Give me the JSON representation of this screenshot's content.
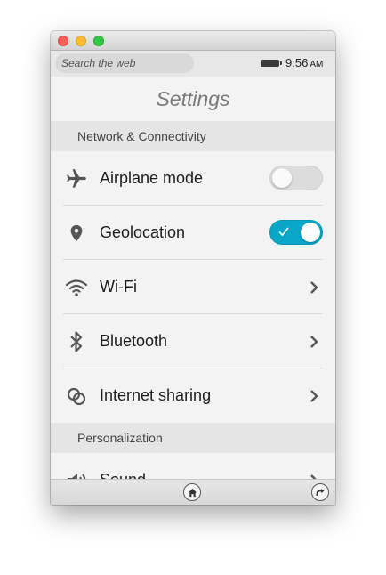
{
  "statusbar": {
    "search_placeholder": "Search the web",
    "time": "9:56",
    "ampm": "AM"
  },
  "header": {
    "title": "Settings"
  },
  "sections": {
    "network": {
      "title": "Network & Connectivity",
      "items": [
        {
          "label": "Airplane mode",
          "icon": "airplane-icon",
          "control": "toggle",
          "on": false
        },
        {
          "label": "Geolocation",
          "icon": "location-pin-icon",
          "control": "toggle",
          "on": true
        },
        {
          "label": "Wi-Fi",
          "icon": "wifi-icon",
          "control": "chevron"
        },
        {
          "label": "Bluetooth",
          "icon": "bluetooth-icon",
          "control": "chevron"
        },
        {
          "label": "Internet sharing",
          "icon": "link-icon",
          "control": "chevron"
        }
      ]
    },
    "personalization": {
      "title": "Personalization",
      "items": [
        {
          "label": "Sound",
          "icon": "speaker-icon",
          "control": "chevron"
        }
      ]
    }
  },
  "bottombar": {
    "home_icon": "home-icon",
    "rotate_icon": "rotate-icon"
  },
  "colors": {
    "toggle_on": "#0aa6c9",
    "toggle_off": "#dcdcdc",
    "section_bg": "#e5e5e5",
    "page_bg": "#f3f3f3",
    "icon": "#555555"
  }
}
